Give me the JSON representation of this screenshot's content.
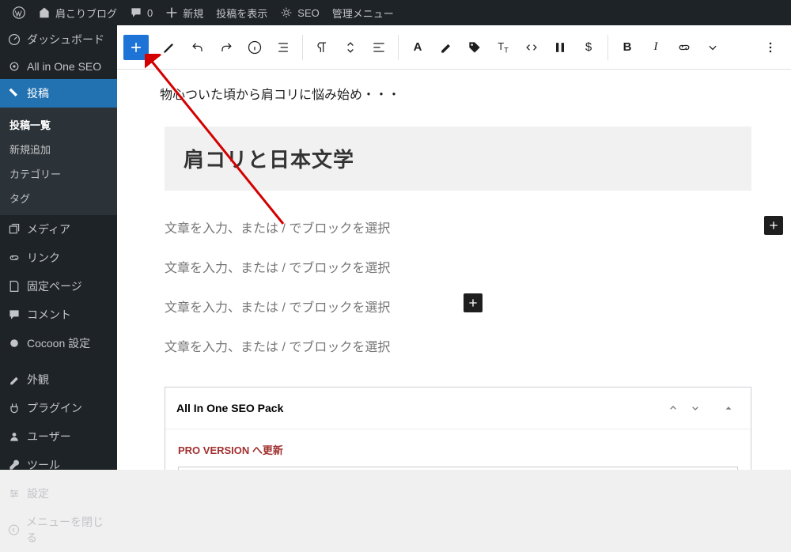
{
  "adminbar": {
    "site": "肩こりブログ",
    "comments": "0",
    "new": "新規",
    "view": "投稿を表示",
    "seo": "SEO",
    "admin_menu": "管理メニュー"
  },
  "sidebar": {
    "dashboard": "ダッシュボード",
    "aioseo": "All in One SEO",
    "posts": "投稿",
    "posts_sub": {
      "list": "投稿一覧",
      "add": "新規追加",
      "cat": "カテゴリー",
      "tag": "タグ"
    },
    "media": "メディア",
    "link": "リンク",
    "pages": "固定ページ",
    "comments": "コメント",
    "cocoon": "Cocoon 設定",
    "appearance": "外観",
    "plugins": "プラグイン",
    "users": "ユーザー",
    "tools": "ツール",
    "settings": "設定",
    "collapse": "メニューを閉じる"
  },
  "editor": {
    "intro": "物心ついた頃から肩コリに悩み始め・・・",
    "heading": "肩コリと日本文学",
    "placeholder": "文章を入力、または / でブロックを選択"
  },
  "metabox": {
    "title": "All In One SEO Pack",
    "pro": "PRO VERSION へ更新"
  }
}
